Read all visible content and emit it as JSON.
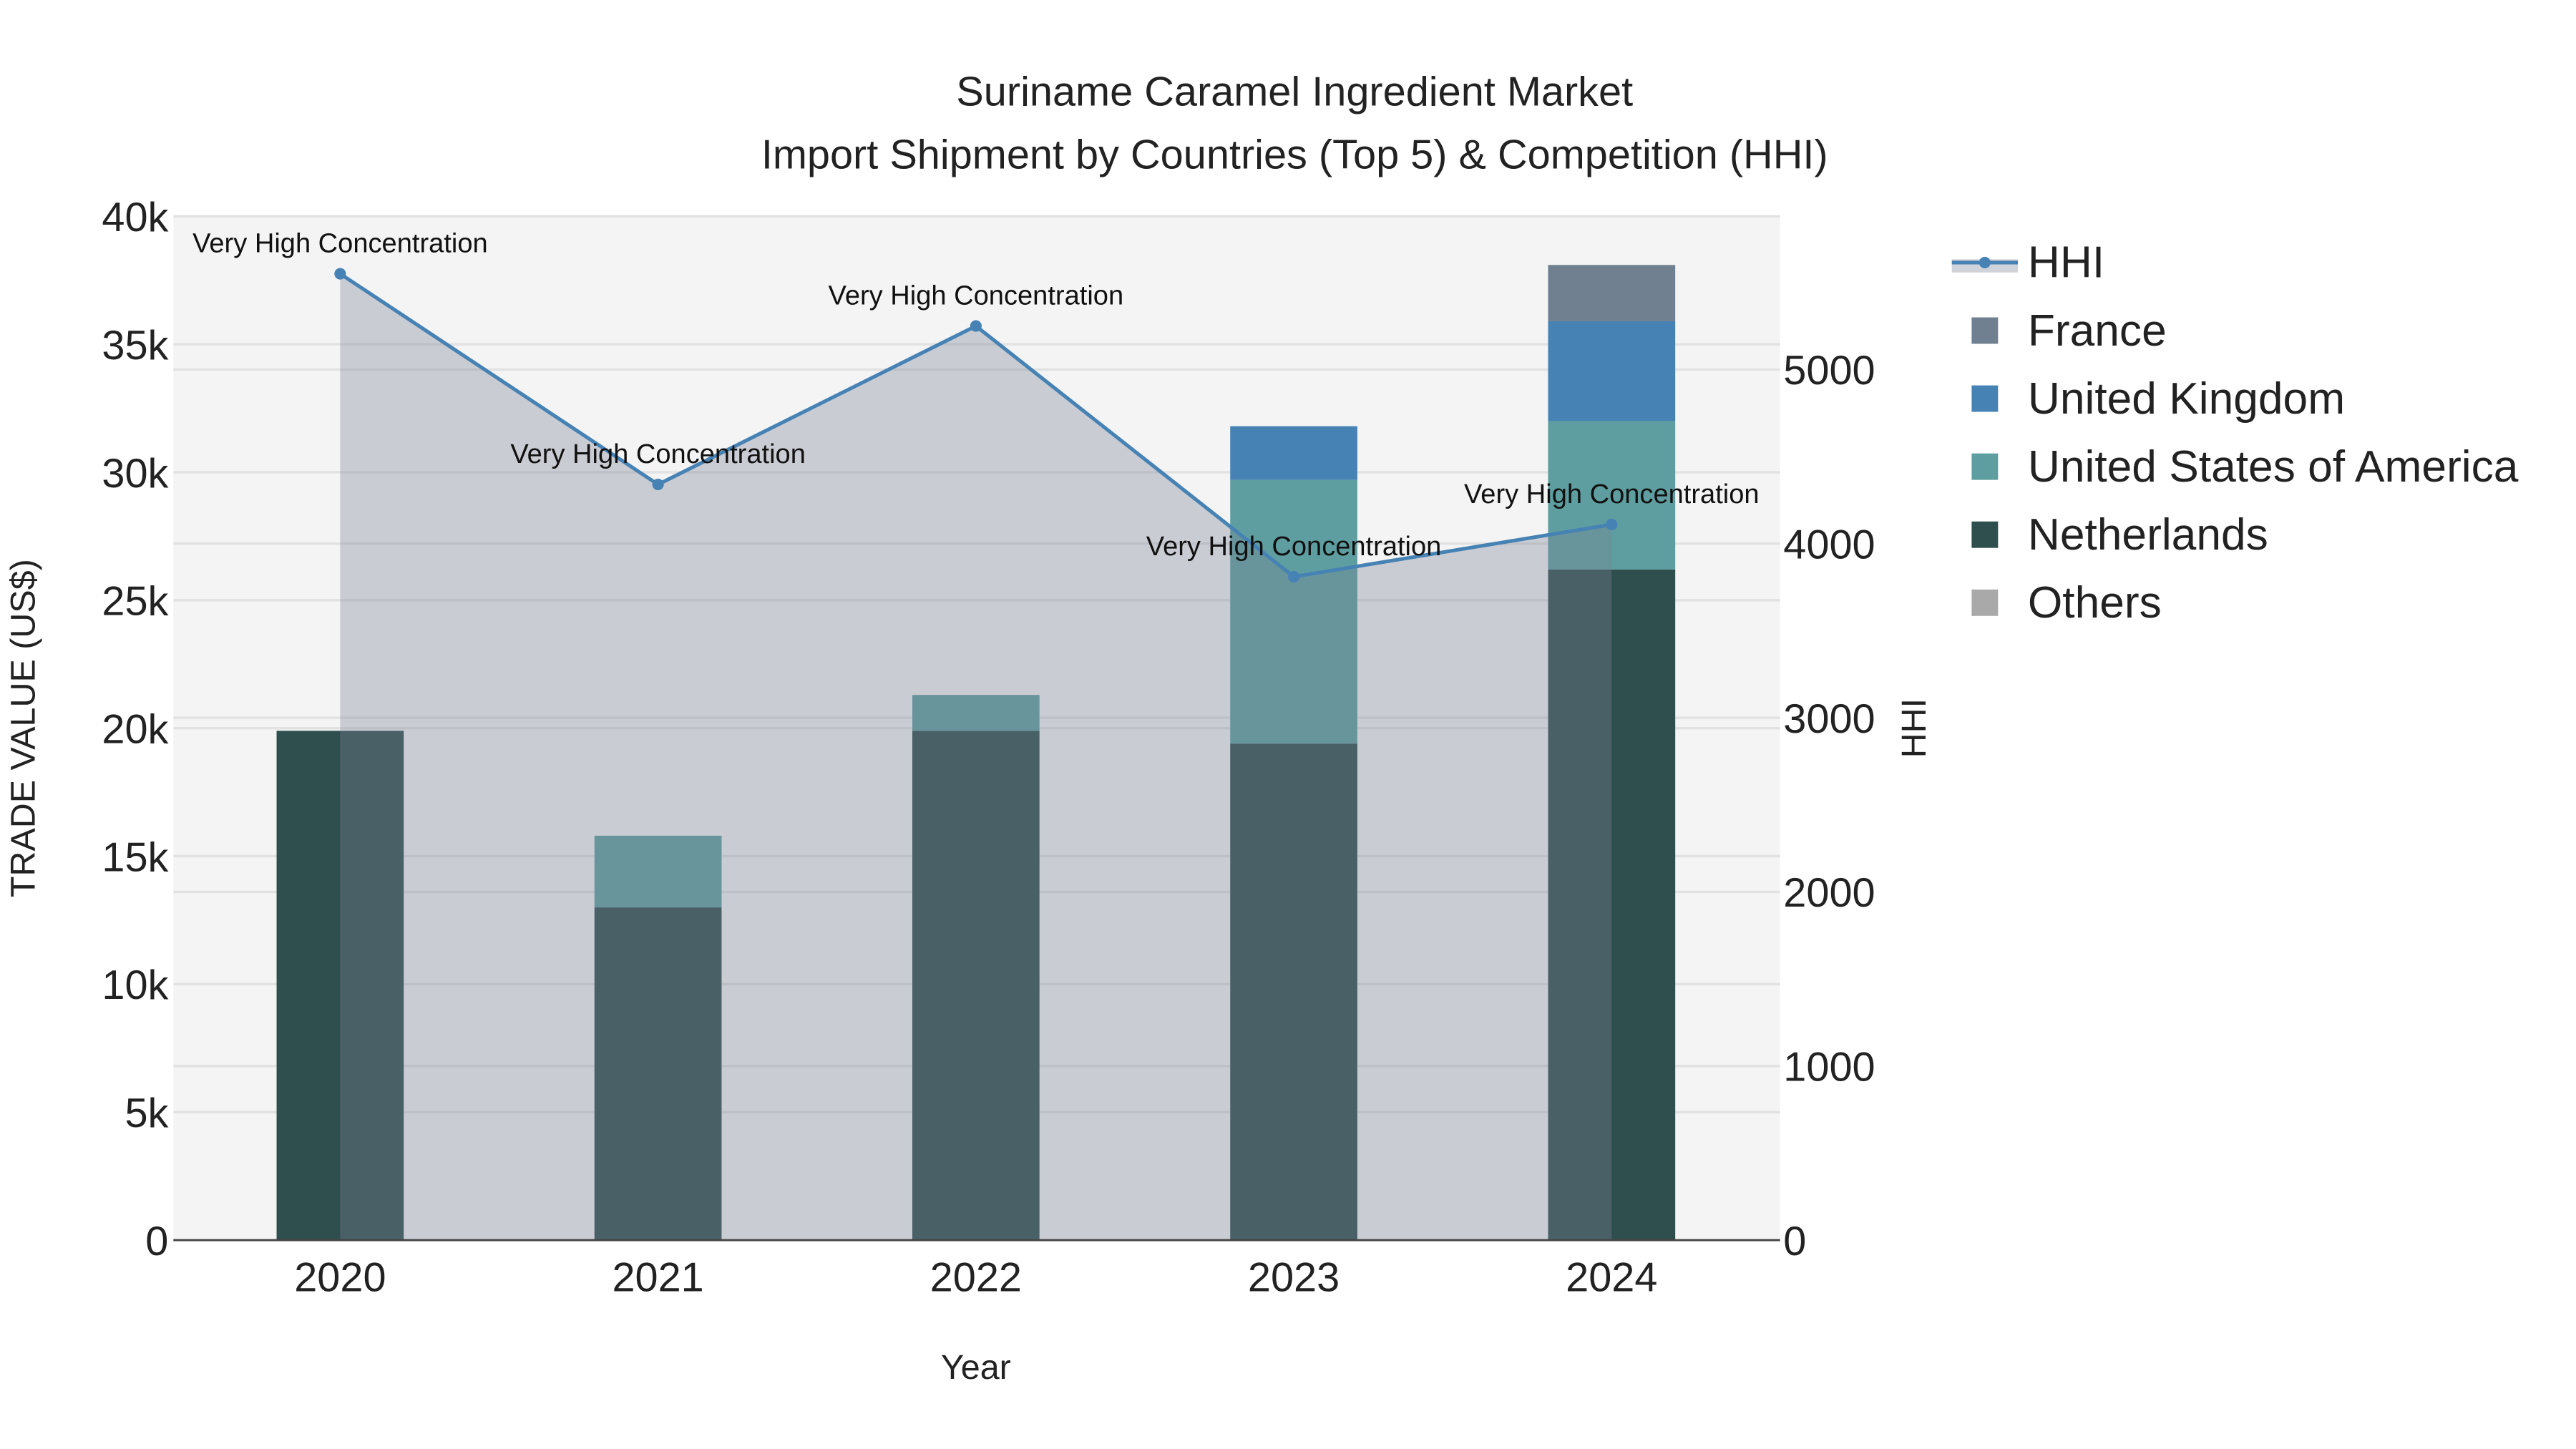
{
  "chart_data": {
    "type": "bar",
    "title_line1": "Suriname Caramel Ingredient Market",
    "title_line2": "Import Shipment by Countries (Top 5) & Competition (HHI)",
    "xlabel": "Year",
    "ylabel": "TRADE VALUE (US$)",
    "y2label": "HHI",
    "categories": [
      "2020",
      "2021",
      "2022",
      "2023",
      "2024"
    ],
    "ylim": [
      0,
      40000
    ],
    "y2lim": [
      0,
      5880
    ],
    "yticks": [
      0,
      5000,
      10000,
      15000,
      20000,
      25000,
      30000,
      35000,
      40000
    ],
    "ytick_labels": [
      "0",
      "5k",
      "10k",
      "15k",
      "20k",
      "25k",
      "30k",
      "35k",
      "40k"
    ],
    "y2ticks": [
      0,
      1000,
      2000,
      3000,
      4000,
      5000
    ],
    "y2tick_labels": [
      "0",
      "1000",
      "2000",
      "3000",
      "4000",
      "5000"
    ],
    "series": [
      {
        "name": "Others",
        "color": "#a9a9a9",
        "values": [
          0,
          0,
          0,
          0,
          0
        ]
      },
      {
        "name": "Netherlands",
        "color": "#2f4f4f",
        "values": [
          19900,
          13000,
          19900,
          19400,
          26200
        ]
      },
      {
        "name": "United States of America",
        "color": "#5f9ea0",
        "values": [
          0,
          2800,
          1400,
          10300,
          5800
        ]
      },
      {
        "name": "United Kingdom",
        "color": "#4682b4",
        "values": [
          0,
          0,
          0,
          2100,
          3900
        ]
      },
      {
        "name": "France",
        "color": "#708090",
        "values": [
          0,
          0,
          0,
          0,
          2200
        ]
      }
    ],
    "hhi": {
      "name": "HHI",
      "color": "#4682b4",
      "values": [
        5550,
        4340,
        5250,
        3810,
        4110
      ],
      "annotations": [
        "Very High Concentration",
        "Very High Concentration",
        "Very High Concentration",
        "Very High Concentration",
        "Very High Concentration"
      ]
    },
    "legend": [
      "HHI",
      "France",
      "United Kingdom",
      "United States of America",
      "Netherlands",
      "Others"
    ],
    "legend_position": "right",
    "grid": true
  }
}
